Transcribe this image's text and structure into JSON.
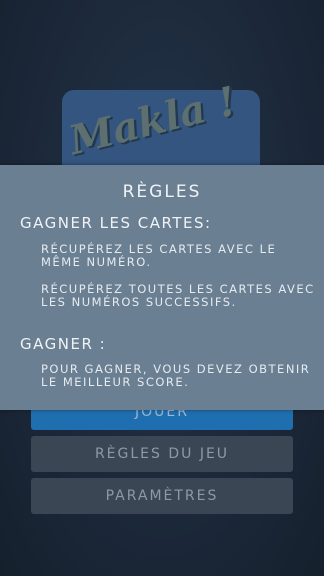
{
  "logo": {
    "text": "Makla !"
  },
  "menu": {
    "play_label": "Jouer",
    "rules_label": "Règles du jeu",
    "settings_label": "Paramètres"
  },
  "rules_dialog": {
    "title": "RÈGLES",
    "section1_title": "Gagner les cartes:",
    "rule1": "Récupérez les cartes avec le même numéro.",
    "rule2": "Récupérez toutes les cartes avec les numéros successifs.",
    "section2_title": "Gagner :",
    "rule3": "Pour gagner, vous devez obtenir le meilleur score."
  },
  "colors": {
    "background": "#1b2838",
    "overlay": "#6a7f92",
    "play_button": "#1f6fb0",
    "secondary_button": "#3b4654",
    "logo_card": "#33557f"
  }
}
